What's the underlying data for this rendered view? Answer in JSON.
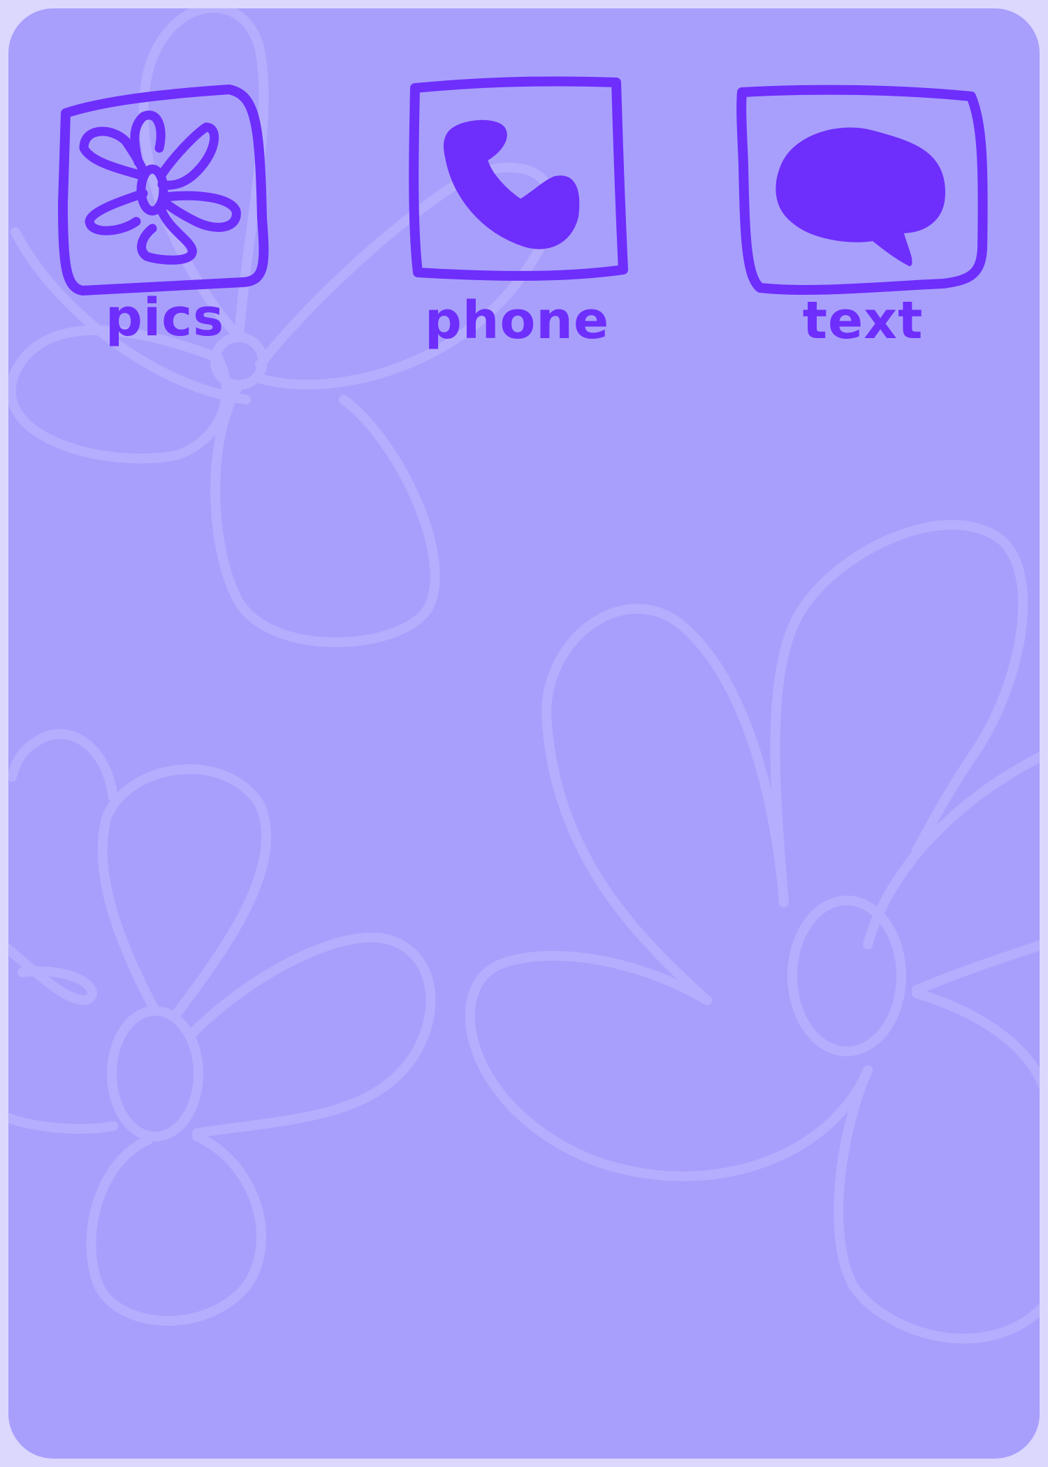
{
  "colors": {
    "frame": "#dcd8fd",
    "background": "#a89ffd",
    "accent": "#6e2efc",
    "flower_outline": "#b5adfd"
  },
  "wallpaper": {
    "pattern": "flower-outlines"
  },
  "apps": [
    {
      "id": "pics",
      "label": "pics",
      "icon": "flower-icon"
    },
    {
      "id": "phone",
      "label": "phone",
      "icon": "phone-handset-icon"
    },
    {
      "id": "text",
      "label": "text",
      "icon": "speech-bubble-icon"
    }
  ]
}
